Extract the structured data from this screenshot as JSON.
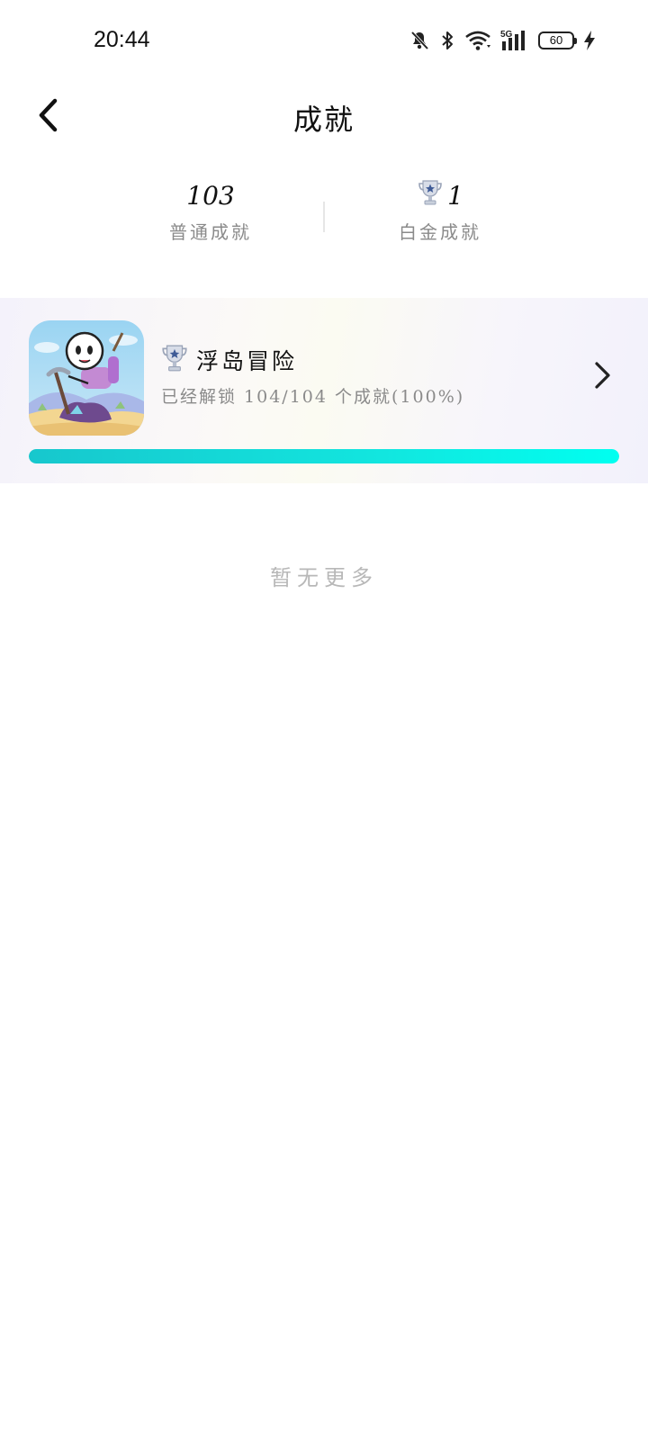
{
  "status_bar": {
    "time": "20:44",
    "network": "5G",
    "battery": "60",
    "icons": [
      "bell-muted-icon",
      "bluetooth-icon",
      "wifi-icon",
      "signal-5g-icon",
      "battery-icon",
      "charging-bolt-icon"
    ]
  },
  "header": {
    "title": "成就",
    "back_icon": "chevron-left-icon"
  },
  "stats": {
    "normal": {
      "value": "103",
      "label": "普通成就"
    },
    "platinum": {
      "value": "1",
      "label": "白金成就",
      "icon": "platinum-trophy-icon"
    }
  },
  "games": [
    {
      "name": "浮岛冒险",
      "progress_text": "已经解锁 104/104 个成就(100%)",
      "progress_fraction": 1.0,
      "icon": "game-icon-floating-island-adventure",
      "trophy_icon": "platinum-trophy-icon"
    }
  ],
  "footer": {
    "no_more": "暂无更多"
  },
  "colors": {
    "progress_start": "#17c7cd",
    "progress_end": "#00fff0",
    "label_gray": "#8a8a8a",
    "muted_gray": "#b8b8b8"
  }
}
